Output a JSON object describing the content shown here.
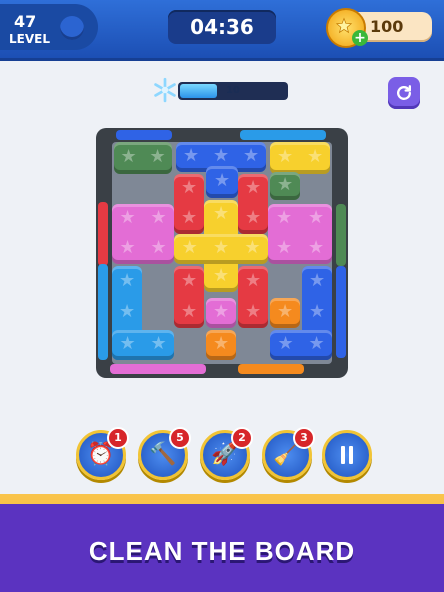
{
  "header": {
    "level_number": "47",
    "level_label": "LEVEL",
    "timer": "04:36",
    "coins": "100"
  },
  "progress": {
    "value": "10",
    "fraction": 0.35,
    "icon": "snowflake-icon"
  },
  "controls": {
    "restart_icon": "restart-icon"
  },
  "powerups": [
    {
      "name": "freeze-clock",
      "count": "1",
      "icon": "clock-icon"
    },
    {
      "name": "hammer",
      "count": "5",
      "icon": "hammer-icon"
    },
    {
      "name": "rocket",
      "count": "2",
      "icon": "rocket-icon"
    },
    {
      "name": "vacuum",
      "count": "3",
      "icon": "vacuum-icon"
    }
  ],
  "pause_icon": "pause-icon",
  "banner": {
    "text": "CLEAN THE BOARD"
  },
  "colors": {
    "green": "#4f8a55",
    "blue": "#2f63e6",
    "yellow": "#f7d02d",
    "red": "#e53a43",
    "pink": "#e36dd5",
    "sky": "#2a9be8",
    "orange": "#f58a1e",
    "purple_banner": "#5b33c0"
  }
}
